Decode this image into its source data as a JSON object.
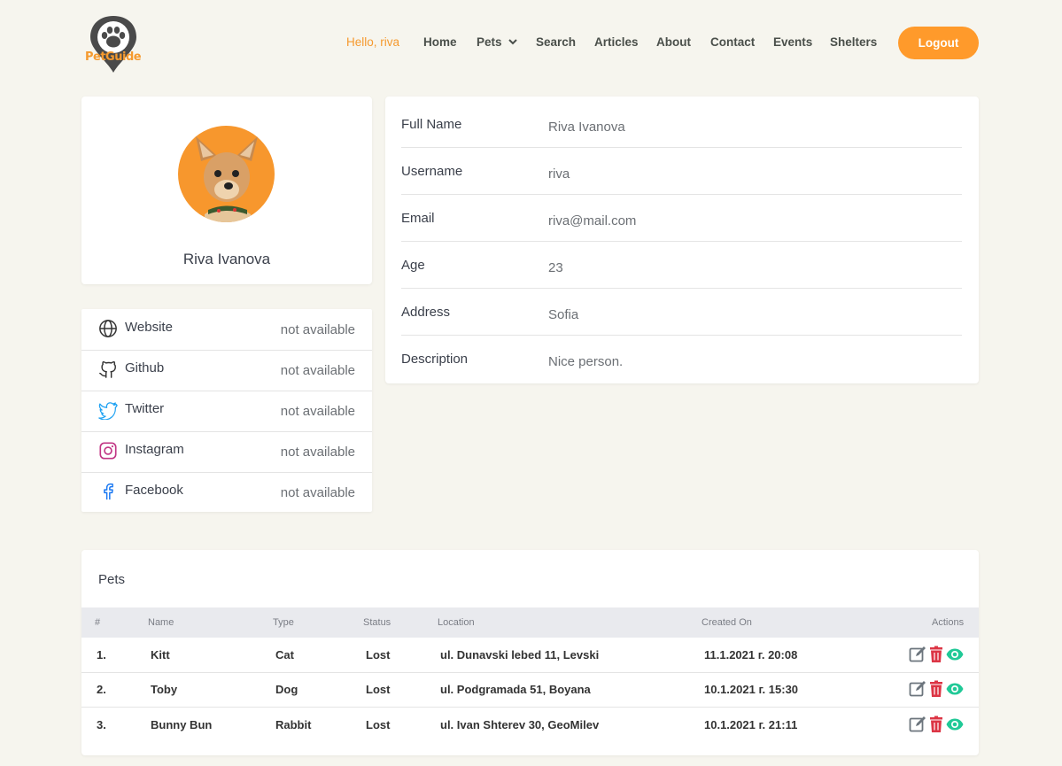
{
  "header": {
    "logo_text": "PetGuide",
    "nav": {
      "hello": "Hello, riva",
      "home": "Home",
      "pets": "Pets",
      "search": "Search",
      "articles": "Articles",
      "about": "About",
      "contact": "Contact",
      "events": "Events",
      "shelters": "Shelters"
    },
    "logout_label": "Logout"
  },
  "profile": {
    "name": "Riva Ivanova"
  },
  "social": [
    {
      "label": "Website",
      "value": "not available",
      "icon": "globe-icon"
    },
    {
      "label": "Github",
      "value": "not available",
      "icon": "github-icon"
    },
    {
      "label": "Twitter",
      "value": "not available",
      "icon": "twitter-icon"
    },
    {
      "label": "Instagram",
      "value": "not available",
      "icon": "instagram-icon"
    },
    {
      "label": "Facebook",
      "value": "not available",
      "icon": "facebook-icon"
    }
  ],
  "info": [
    {
      "label": "Full Name",
      "value": "Riva Ivanova"
    },
    {
      "label": "Username",
      "value": "riva"
    },
    {
      "label": "Email",
      "value": "riva@mail.com"
    },
    {
      "label": "Age",
      "value": "23"
    },
    {
      "label": "Address",
      "value": "Sofia"
    },
    {
      "label": "Description",
      "value": "Nice person."
    }
  ],
  "pets": {
    "title": "Pets",
    "columns": [
      "#",
      "Name",
      "Type",
      "Status",
      "Location",
      "Created On",
      "Actions"
    ],
    "rows": [
      {
        "num": "1.",
        "name": "Kitt",
        "type": "Cat",
        "status": "Lost",
        "location": "ul. Dunavski lebed 11, Levski",
        "created": "11.1.2021 г. 20:08"
      },
      {
        "num": "2.",
        "name": "Toby",
        "type": "Dog",
        "status": "Lost",
        "location": "ul. Podgramada 51, Boyana",
        "created": "10.1.2021 г. 15:30"
      },
      {
        "num": "3.",
        "name": "Bunny Bun",
        "type": "Rabbit",
        "status": "Lost",
        "location": "ul. Ivan Shterev 30, GeoMilev",
        "created": "10.1.2021 г. 21:11"
      }
    ]
  },
  "colors": {
    "accent": "#ff9a2b",
    "background": "#f6f5ee",
    "edit": "#6c757d",
    "delete": "#dc3545",
    "view": "#20c997"
  }
}
